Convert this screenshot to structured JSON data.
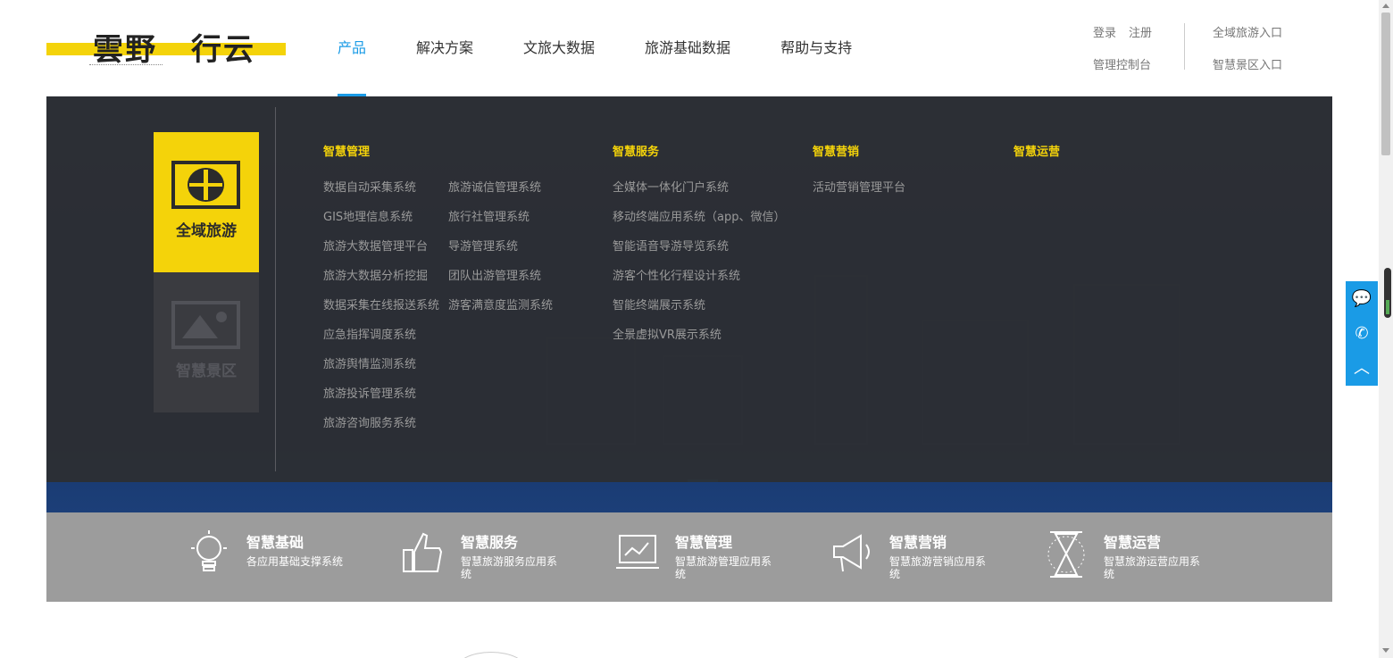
{
  "logo": {
    "part1": "雲野",
    "part2": "行云"
  },
  "nav": [
    {
      "label": "产品",
      "active": true
    },
    {
      "label": "解决方案",
      "active": false
    },
    {
      "label": "文旅大数据",
      "active": false
    },
    {
      "label": "旅游基础数据",
      "active": false
    },
    {
      "label": "帮助与支持",
      "active": false
    }
  ],
  "top_links": {
    "login": "登录",
    "register": "注册",
    "console": "管理控制台",
    "global_tour_entry": "全域旅游入口",
    "smart_scenic_entry": "智慧景区入口"
  },
  "dropdown": {
    "cards": [
      {
        "label": "全域旅游",
        "icon": "globe-icon"
      },
      {
        "label": "智慧景区",
        "icon": "picture-icon"
      }
    ],
    "columns": [
      {
        "head": "智慧管理",
        "items_a": [
          "数据自动采集系统",
          "GIS地理信息系统",
          "旅游大数据管理平台",
          "旅游大数据分析挖掘",
          "数据采集在线报送系统",
          "应急指挥调度系统",
          "旅游舆情监测系统",
          "旅游投诉管理系统",
          "旅游咨询服务系统"
        ],
        "items_b": [
          "旅游诚信管理系统",
          "旅行社管理系统",
          "导游管理系统",
          "团队出游管理系统",
          "游客满意度监测系统"
        ]
      },
      {
        "head": "智慧服务",
        "items": [
          "全媒体一体化门户系统",
          "移动终端应用系统（app、微信）",
          "智能语音导游导览系统",
          "游客个性化行程设计系统",
          "智能终端展示系统",
          "全景虚拟VR展示系统"
        ]
      },
      {
        "head": "智慧营销",
        "items": [
          "活动营销管理平台"
        ]
      },
      {
        "head": "智慧运营",
        "items": []
      }
    ]
  },
  "features": [
    {
      "title": "智慧基础",
      "desc": "各应用基础支撑系统",
      "icon": "lightbulb-icon"
    },
    {
      "title": "智慧服务",
      "desc": "智慧旅游服务应用系统",
      "icon": "thumbs-up-icon"
    },
    {
      "title": "智慧管理",
      "desc": "智慧旅游管理应用系统",
      "icon": "laptop-chart-icon"
    },
    {
      "title": "智慧营销",
      "desc": "智慧旅游营销应用系统",
      "icon": "megaphone-icon"
    },
    {
      "title": "智慧运营",
      "desc": "智慧旅游运营应用系统",
      "icon": "hourglass-icon"
    }
  ],
  "float_bar": {
    "chat": "💬",
    "phone": "✆",
    "top": "︿"
  },
  "colors": {
    "accent": "#1a9be6",
    "brand_yellow": "#f4d30a",
    "dropdown_bg": "#2c2e34",
    "feature_bg": "#9c9c9c"
  }
}
